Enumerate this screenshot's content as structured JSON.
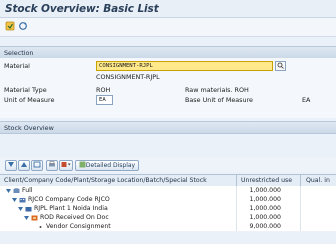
{
  "window": {
    "title": "Stock Overview: Basic List"
  },
  "toolbar": {
    "items": [
      "execute-icon",
      "refresh-icon"
    ]
  },
  "selection": {
    "header": "Selection",
    "material_label": "Material",
    "material_value": "CONSIGNMENT-RJPL",
    "material_desc": "CONSIGNMENT-RJPL",
    "material_type_label": "Material Type",
    "material_type_value": "ROH",
    "material_type_desc": "Raw materials. ROH",
    "uom_label": "Unit of Measure",
    "uom_value": "EA",
    "base_uom_label": "Base Unit of Measure",
    "base_uom_value": "EA"
  },
  "stock_overview": {
    "header": "Stock Overview",
    "detailed_display_label": "Detailed Display",
    "columns": [
      "Client/Company Code/Plant/Storage Location/Batch/Special Stock",
      "Unrestricted use",
      "Qual. in"
    ],
    "rows": [
      {
        "label": "Full",
        "qty": "1,000.000"
      },
      {
        "label": "RJCO Company Code RJCO",
        "qty": "1,000.000"
      },
      {
        "label": "RJPL Plant 1 Noida India",
        "qty": "1,000.000"
      },
      {
        "label": "ROD Received On Doc",
        "qty": "1,000.000"
      },
      {
        "label": "Vendor Consignment",
        "qty": "9,000.000"
      }
    ]
  },
  "colors": {
    "title_text": "#2a3f5a",
    "highlight": "#ffe98a",
    "section": "#cbd9e8"
  }
}
